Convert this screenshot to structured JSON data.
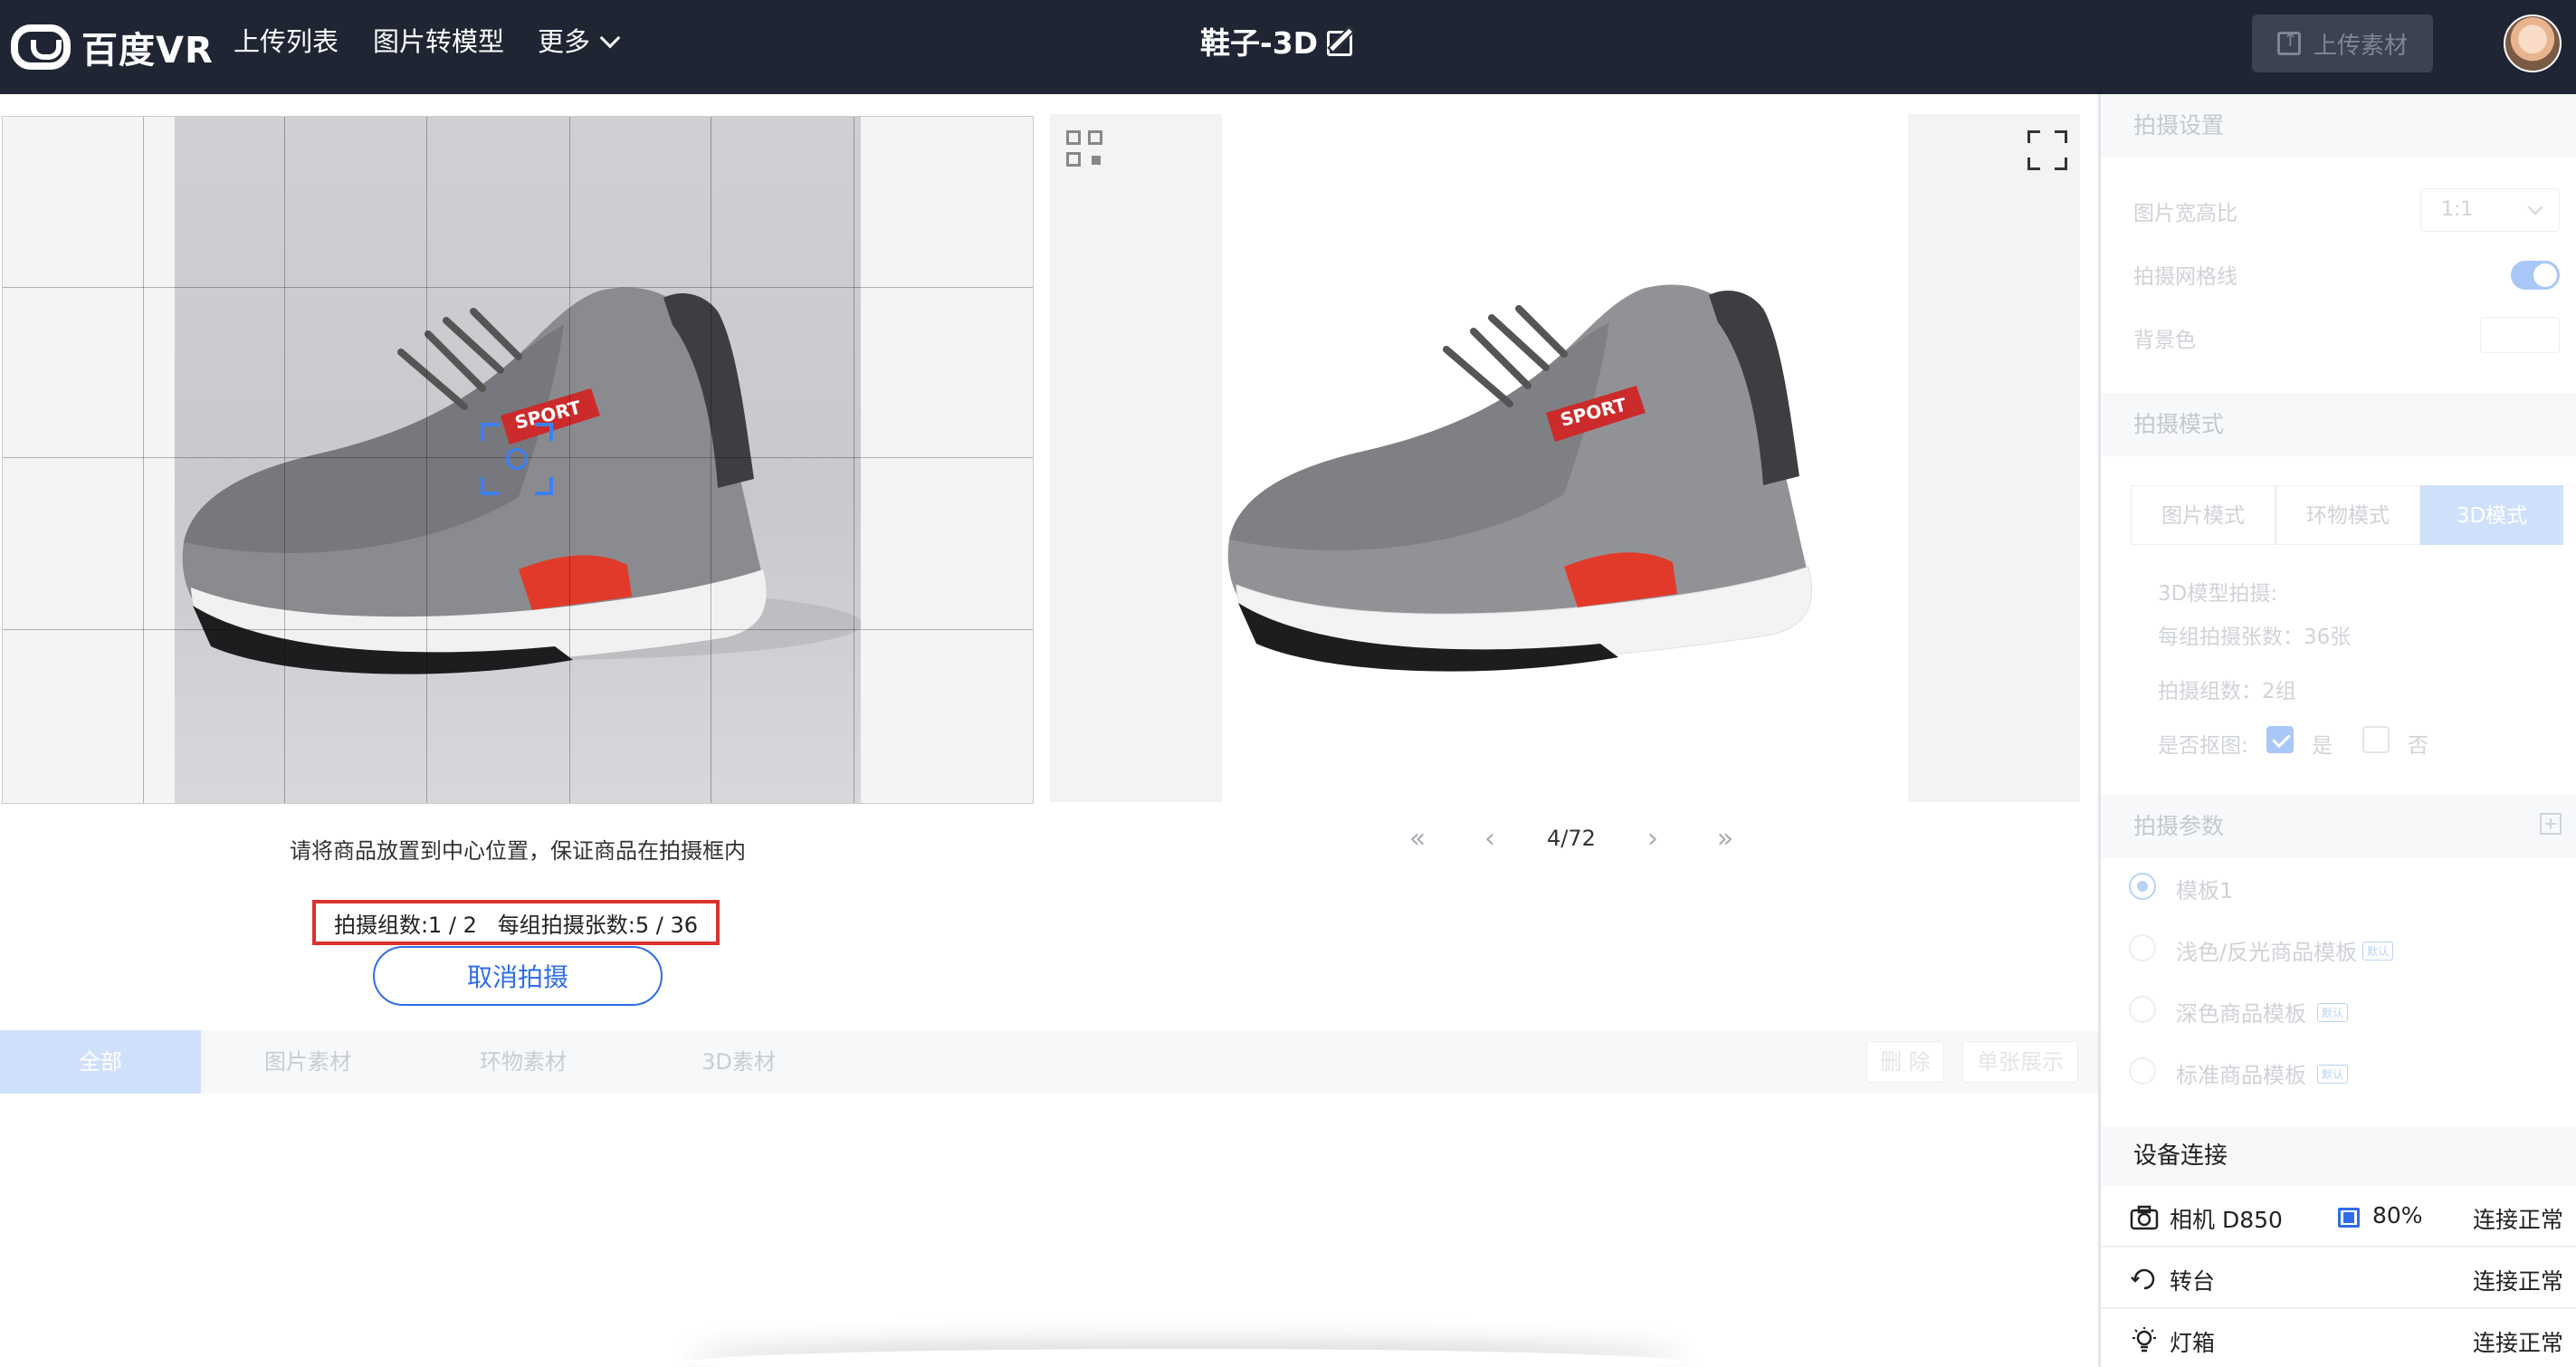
{
  "header": {
    "logo_text": "百度VR",
    "nav": [
      "上传列表",
      "图片转模型",
      "更多"
    ],
    "title": "鞋子-3D",
    "upload_label": "上传素材"
  },
  "capture": {
    "hint": "请将商品放置到中心位置，保证商品在拍摄框内",
    "counter": "拍摄组数:1 / 2   每组拍摄张数:5 / 36",
    "cancel_label": "取消拍摄"
  },
  "preview": {
    "page": "4/72",
    "shoe_brand": "SPORT"
  },
  "tabs": {
    "items": [
      "全部",
      "图片素材",
      "环物素材",
      "3D素材"
    ],
    "active": "全部",
    "delete_label": "删 除",
    "single_label": "单张展示"
  },
  "sidebar": {
    "shoot_settings": {
      "title": "拍摄设置",
      "ratio_label": "图片宽高比",
      "ratio_value": "1:1",
      "grid_label": "拍摄网格线",
      "grid_on": true,
      "bg_label": "背景色",
      "bg_color": "#ffffff"
    },
    "shoot_mode": {
      "title": "拍摄模式",
      "modes": [
        "图片模式",
        "环物模式",
        "3D模式"
      ],
      "active": "3D模式",
      "model_title": "3D模型拍摄:",
      "per_group": "每组拍摄张数：36张",
      "groups": "拍摄组数：2组",
      "matting_label": "是否抠图:",
      "yes": "是",
      "no": "否",
      "matting": "是"
    },
    "shoot_params": {
      "title": "拍摄参数",
      "templates": [
        {
          "label": "模板1",
          "badge": ""
        },
        {
          "label": "浅色/反光商品模板",
          "badge": "默认"
        },
        {
          "label": "深色商品模板",
          "badge": "默认"
        },
        {
          "label": "标准商品模板",
          "badge": "默认"
        }
      ],
      "selected": "模板1"
    },
    "devices": {
      "title": "设备连接",
      "items": [
        {
          "name": "相机 D850",
          "battery": "80%",
          "status": "连接正常"
        },
        {
          "name": "转台",
          "status": "连接正常"
        },
        {
          "name": "灯箱",
          "status": "连接正常"
        }
      ]
    }
  },
  "colors": {
    "topbar": "#1f2533",
    "accent": "#2f6dea",
    "highlight_box": "#d9332c"
  }
}
